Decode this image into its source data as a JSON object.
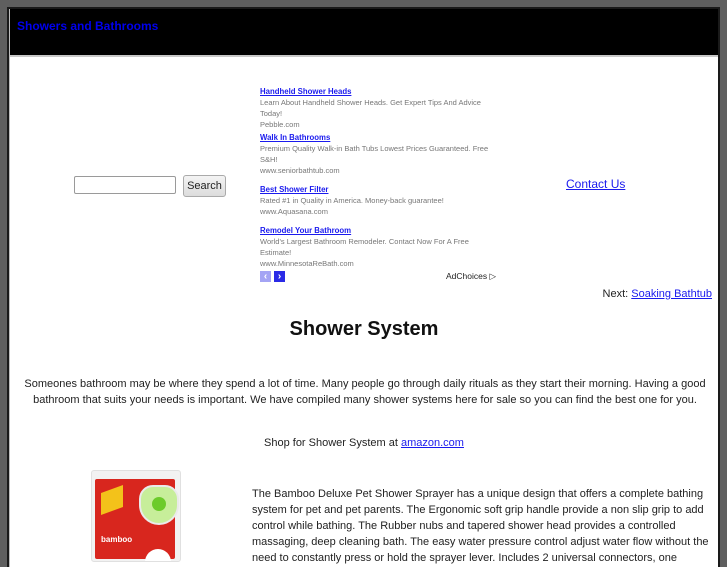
{
  "header": {
    "site_title": "Showers and Bathrooms"
  },
  "search": {
    "value": "",
    "placeholder": "",
    "button_label": "Search"
  },
  "ads": {
    "items": [
      {
        "title": "Handheld Shower Heads",
        "description": "Learn About Handheld Shower Heads. Get Expert Tips And Advice Today!",
        "url": "Pebble.com"
      },
      {
        "title": "Walk In Bathrooms",
        "description": "Premium Quality Walk-in Bath Tubs Lowest Prices Guaranteed. Free S&H!",
        "url": "www.seniorbathtub.com"
      },
      {
        "title": "Best Shower Filter",
        "description": "Rated #1 in Quality in America. Money-back guarantee!",
        "url": "www.Aquasana.com"
      },
      {
        "title": "Remodel Your Bathroom",
        "description": "World's Largest Bathroom Remodeler. Contact Now For A Free Estimate!",
        "url": "www.MinnesotaReBath.com"
      }
    ],
    "prev_icon": "‹",
    "next_icon": "›",
    "adchoices_label": "AdChoices",
    "adchoices_icon": "▷"
  },
  "nav": {
    "contact_label": "Contact Us",
    "next_prefix": "Next:",
    "next_link": "Soaking Bathtub"
  },
  "main": {
    "title": "Shower System",
    "intro": "Someones bathroom may be where they spend a lot of time. Many people go through daily rituals as they start their morning. Having a good bathroom that suits your needs is important. We have compiled many shower systems here for sale so you can find the best one for you.",
    "shop_prefix": "Shop for Shower System at",
    "shop_link": "amazon.com"
  },
  "product": {
    "image_alt": "Bamboo Deluxe Pet Shower Sprayer package",
    "brand_text": "bamboo",
    "description": "The Bamboo Deluxe Pet Shower Sprayer has a unique design that offers a complete bathing system for pet and pet parents. The Ergonomic soft grip handle provide a non slip grip to add control while bathing. The Rubber nubs and tapered shower head provides a controlled massaging, deep cleaning bath. The easy water pressure control adjust water flow without the need to constantly press or hold the sprayer lever. Includes 2 universal connectors, one"
  }
}
